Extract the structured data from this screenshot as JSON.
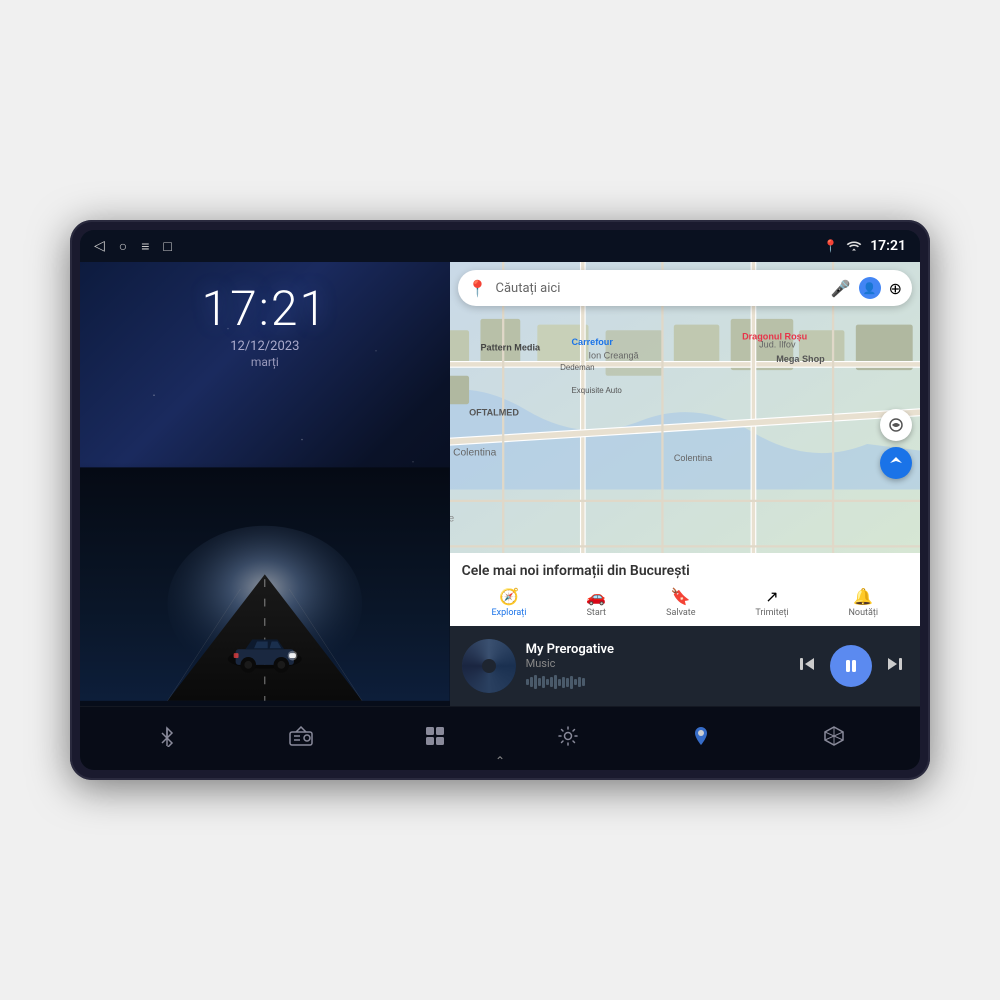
{
  "device": {
    "status_bar": {
      "time": "17:21",
      "wifi_icon": "wifi",
      "location_icon": "📍",
      "nav_back": "◁",
      "nav_home": "○",
      "nav_menu": "≡",
      "nav_screenshot": "□"
    },
    "lock_screen": {
      "time": "17:21",
      "date": "12/12/2023",
      "weekday": "marți"
    },
    "map": {
      "search_placeholder": "Căutați aici",
      "info_title": "Cele mai noi informații din București",
      "tabs": [
        {
          "label": "Explorați",
          "icon": "🧭",
          "active": true
        },
        {
          "label": "Start",
          "icon": "🚗"
        },
        {
          "label": "Salvate",
          "icon": "🔖"
        },
        {
          "label": "Trimiteți",
          "icon": "↗"
        },
        {
          "label": "Noutăți",
          "icon": "🔔"
        }
      ]
    },
    "music": {
      "title": "My Prerogative",
      "subtitle": "Music",
      "prev_label": "⏮",
      "play_label": "⏸",
      "next_label": "⏭"
    },
    "bottom_nav": [
      {
        "icon": "bluetooth",
        "label": ""
      },
      {
        "icon": "radio",
        "label": ""
      },
      {
        "icon": "apps",
        "label": ""
      },
      {
        "icon": "settings",
        "label": ""
      },
      {
        "icon": "maps",
        "label": ""
      },
      {
        "icon": "3d-cube",
        "label": ""
      }
    ]
  }
}
